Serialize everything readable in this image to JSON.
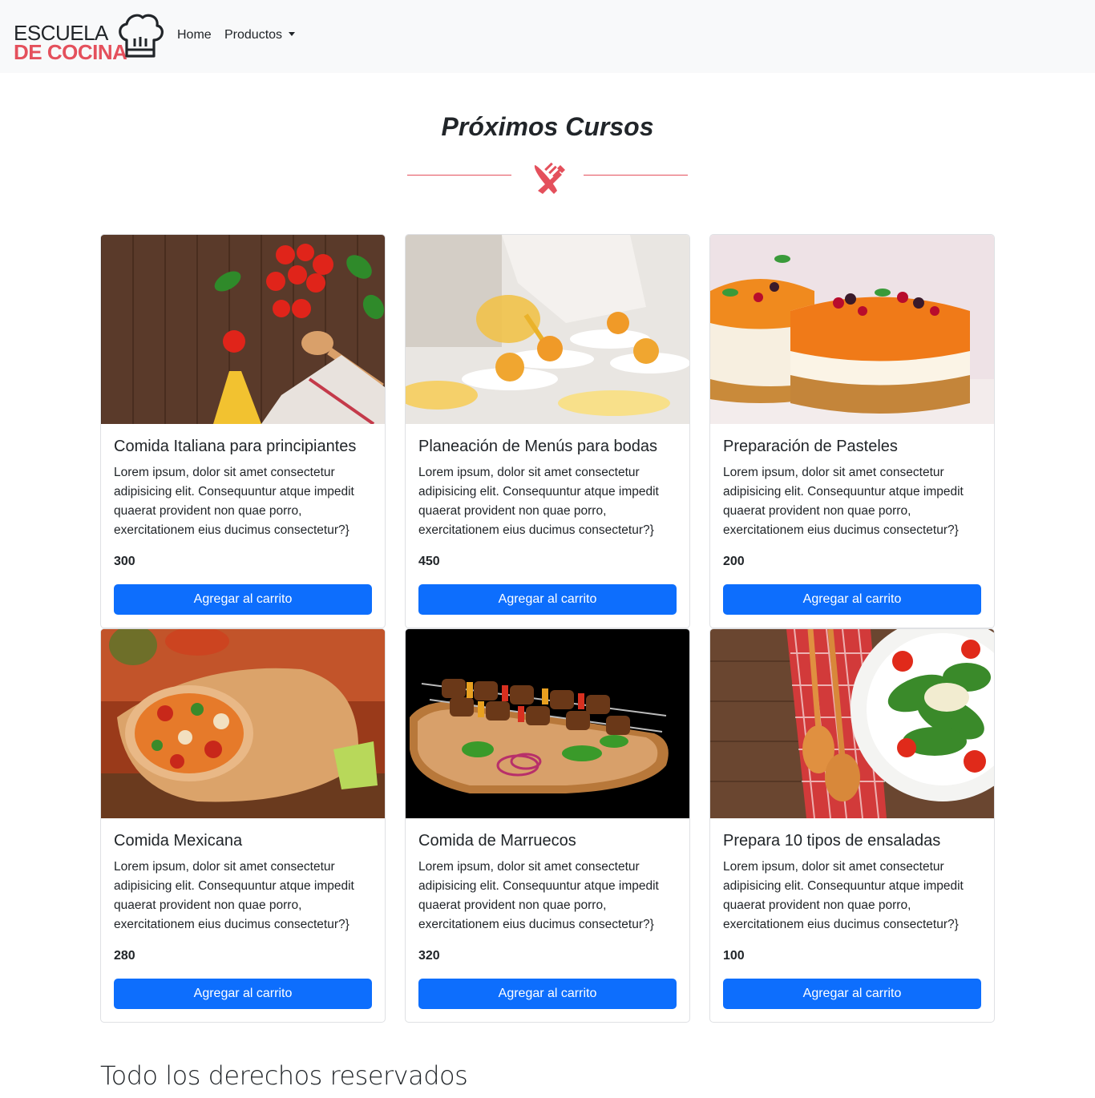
{
  "brand": {
    "line1": "ESCUELA",
    "line2": "DE COCINA",
    "accent_color": "#e4505c",
    "icon": "chef-hat-icon"
  },
  "nav": {
    "home": "Home",
    "productos": "Productos"
  },
  "section": {
    "title": "Próximos Cursos",
    "divider_icon": "fork-knife-icon"
  },
  "cards": [
    {
      "title": "Comida Italiana para principiantes",
      "text": "Lorem ipsum, dolor sit amet consectetur adipisicing elit. Consequuntur atque impedit quaerat provident non quae porro, exercitationem eius ducimus consectetur?}",
      "price": "300",
      "button": "Agregar al carrito",
      "image": "italian-ingredients-image"
    },
    {
      "title": "Planeación de Menús para bodas",
      "text": "Lorem ipsum, dolor sit amet consectetur adipisicing elit. Consequuntur atque impedit quaerat provident non quae porro, exercitationem eius ducimus consectetur?}",
      "price": "450",
      "button": "Agregar al carrito",
      "image": "wedding-menu-plating-image"
    },
    {
      "title": "Preparación de Pasteles",
      "text": "Lorem ipsum, dolor sit amet consectetur adipisicing elit. Consequuntur atque impedit quaerat provident non quae porro, exercitationem eius ducimus consectetur?}",
      "price": "200",
      "button": "Agregar al carrito",
      "image": "cheesecake-image"
    },
    {
      "title": "Comida Mexicana",
      "text": "Lorem ipsum, dolor sit amet consectetur adipisicing elit. Consequuntur atque impedit quaerat provident non quae porro, exercitationem eius ducimus consectetur?}",
      "price": "280",
      "button": "Agregar al carrito",
      "image": "burrito-image"
    },
    {
      "title": "Comida de Marruecos",
      "text": "Lorem ipsum, dolor sit amet consectetur adipisicing elit. Consequuntur atque impedit quaerat provident non quae porro, exercitationem eius ducimus consectetur?}",
      "price": "320",
      "button": "Agregar al carrito",
      "image": "kebab-skewers-image"
    },
    {
      "title": "Prepara 10 tipos de ensaladas",
      "text": "Lorem ipsum, dolor sit amet consectetur adipisicing elit. Consequuntur atque impedit quaerat provident non quae porro, exercitationem eius ducimus consectetur?}",
      "price": "100",
      "button": "Agregar al carrito",
      "image": "salad-plate-image"
    }
  ],
  "footer": {
    "text": "Todo los derechos reservados"
  },
  "colors": {
    "primary_button": "#0d6efd",
    "navbar_bg": "#f8f9fa",
    "accent": "#e4505c"
  }
}
